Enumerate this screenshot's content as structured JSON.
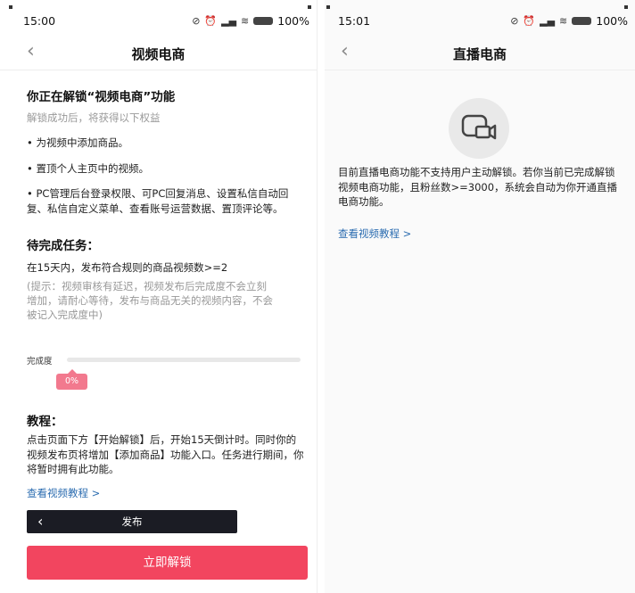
{
  "left": {
    "status": {
      "time": "15:00",
      "battery": "100%"
    },
    "nav": {
      "title": "视频电商"
    },
    "unlock_title": "你正在解锁“视频电商”功能",
    "unlock_subtitle": "解锁成功后，将获得以下权益",
    "benefits": [
      "• 为视频中添加商品。",
      "• 置顶个人主页中的视频。",
      "• PC管理后台登录权限、可PC回复消息、设置私信自动回复、私信自定义菜单、查看账号运营数据、置顶评论等。"
    ],
    "tasks_title": "待完成任务：",
    "task_rule": "在15天内，发布符合规则的商品视频数>=2",
    "task_hint": "(提示：视频审核有延迟，视频发布后完成度不会立刻增加，请耐心等待，发布与商品无关的视频内容，不会被记入完成度中)",
    "progress": {
      "label": "完成度",
      "value": 0,
      "text": "0%"
    },
    "tutorial_title": "教程：",
    "tutorial_body": "点击页面下方【开始解锁】后，开始15天倒计时。同时你的视频发布页将增加【添加商品】功能入口。任务进行期间，你将暂时拥有此功能。",
    "tutorial_link": "查看视频教程 >",
    "publish_label": "发布",
    "unlock_button": "立即解锁"
  },
  "right": {
    "status": {
      "time": "15:01",
      "battery": "100%"
    },
    "nav": {
      "title": "直播电商"
    },
    "body": "目前直播电商功能不支持用户主动解锁。若你当前已完成解锁视频电商功能，且粉丝数>=3000，系统会自动为你开通直播电商功能。",
    "link": "查看视频教程 >"
  },
  "colors": {
    "accent": "#f2455f",
    "link": "#2b6cb0",
    "progress_bubble": "#f2798e",
    "publish_bar": "#1b1c24"
  },
  "icons": {
    "back": "chevron-left-icon",
    "live": "live-video-icon"
  }
}
